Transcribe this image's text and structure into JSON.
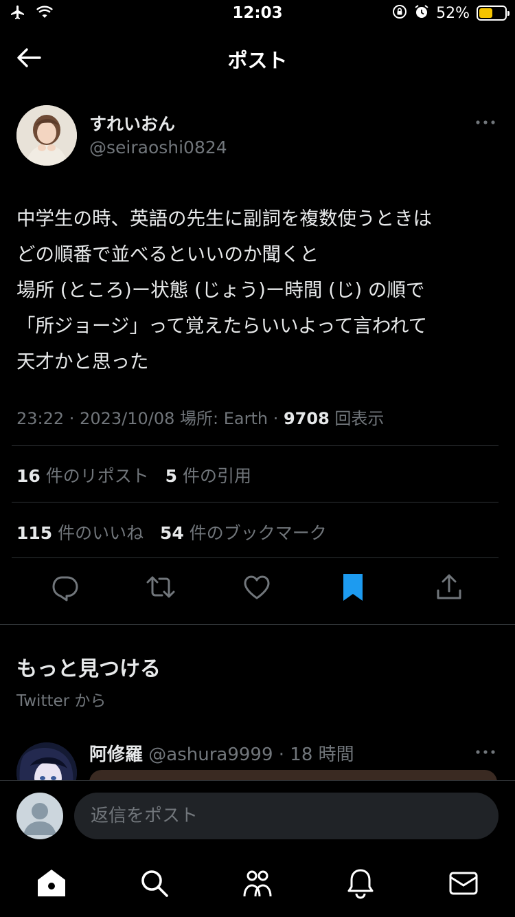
{
  "status_bar": {
    "time": "12:03",
    "battery_percent": "52%",
    "battery_level": 0.52,
    "icons": [
      "airplane-icon",
      "wifi-icon",
      "orientation-lock-icon",
      "alarm-icon",
      "battery-icon"
    ]
  },
  "header": {
    "title": "ポスト",
    "back_icon": "arrow-left-icon"
  },
  "author": {
    "name": "すれいおん",
    "handle": "@seiraoshi0824"
  },
  "tweet": {
    "lines": [
      "中学生の時、英語の先生に副詞を複数使うときは",
      "どの順番で並べるといいのか聞くと",
      "場所 (ところ)ー状態 (じょう)ー時間 (じ) の順で",
      "「所ジョージ」って覚えたらいいよって言われて",
      "天才かと思った"
    ]
  },
  "meta": {
    "prefix": "23:22 · 2023/10/08 場所: Earth · ",
    "views": "9708",
    "views_label": " 回表示"
  },
  "stats": {
    "reposts": "16",
    "reposts_label": " 件のリポスト",
    "quotes": "5",
    "quotes_label": " 件の引用",
    "likes": "115",
    "likes_label": " 件のいいね",
    "bookmarks": "54",
    "bookmarks_label": " 件のブックマーク"
  },
  "actions": [
    "reply-icon",
    "retweet-icon",
    "like-icon",
    "bookmark-icon",
    "share-icon"
  ],
  "colors": {
    "accent": "#1d9bf0",
    "muted": "#71767b",
    "divider": "#2f3336",
    "text": "#e7e9ea"
  },
  "discover": {
    "title": "もっと見つける",
    "subtitle": "Twitter から"
  },
  "recommended": {
    "name": "阿修羅",
    "handle": "@ashura9999",
    "time": " · 18 時間"
  },
  "reply": {
    "placeholder": "返信をポスト"
  },
  "tabs": [
    "home-icon",
    "search-icon",
    "communities-icon",
    "notifications-icon",
    "messages-icon"
  ]
}
